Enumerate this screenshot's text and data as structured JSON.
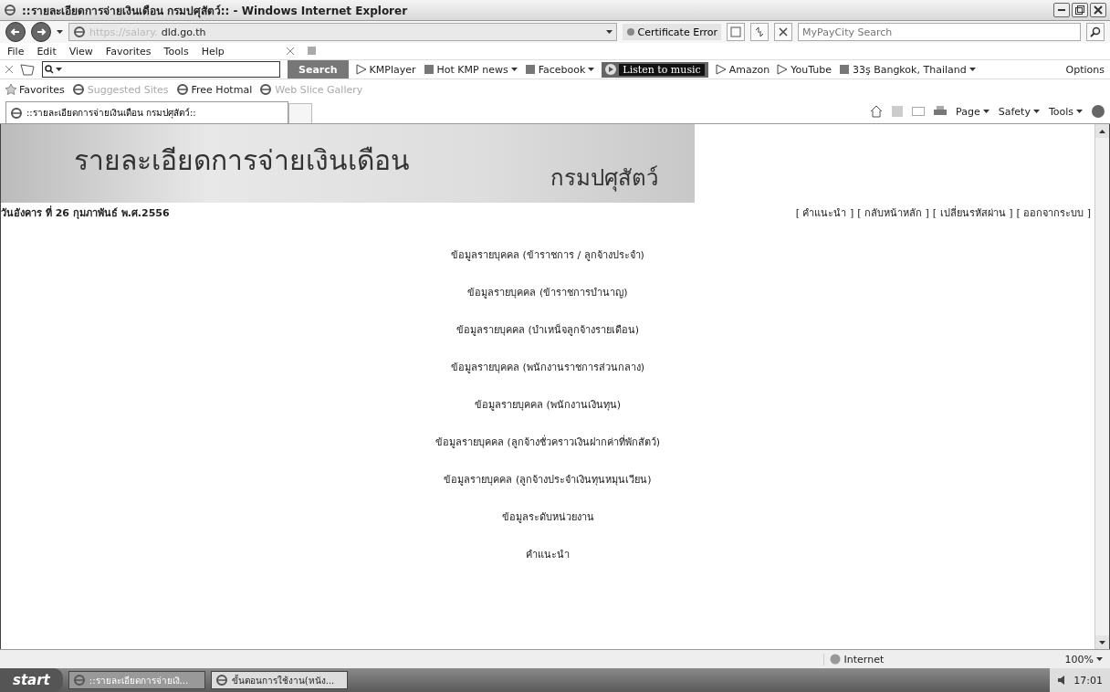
{
  "window": {
    "title": "::รายละเอียดการจ่ายเงินเดือน กรมปศุสัตว์:: - Windows Internet Explorer"
  },
  "address_bar": {
    "url_prefix": "https://salary.",
    "url_domain": "dld.go.th",
    "certificate": "Certificate Error",
    "search_placeholder": "MyPayCity Search"
  },
  "menu_bar": [
    "File",
    "Edit",
    "View",
    "Favorites",
    "Tools",
    "Help"
  ],
  "ask_toolbar": {
    "search_button": "Search",
    "items": [
      {
        "kind": "link",
        "label": "KMPlayer"
      },
      {
        "kind": "dropdown",
        "label": "Hot KMP news"
      },
      {
        "kind": "dropdown",
        "label": "Facebook"
      },
      {
        "kind": "player",
        "label": "Listen to music"
      },
      {
        "kind": "link",
        "label": "Amazon"
      },
      {
        "kind": "link",
        "label": "YouTube"
      },
      {
        "kind": "dropdown",
        "label": "33ş Bangkok, Thailand"
      }
    ],
    "options": "Options"
  },
  "favorites_bar": {
    "label": "Favorites",
    "items": [
      {
        "label": "Suggested Sites",
        "disabled": true
      },
      {
        "label": "Free Hotmal",
        "disabled": false
      },
      {
        "label": "Web Slice Gallery",
        "disabled": true
      }
    ]
  },
  "tab": {
    "title": "::รายละเอียดการจ่ายเงินเดือน กรมปศุสัตว์::"
  },
  "command_bar": [
    "Page",
    "Safety",
    "Tools"
  ],
  "page": {
    "banner_title": "รายละเอียดการจ่ายเงินเดือน",
    "banner_department": "กรมปศุสัตว์",
    "date": "วันอังคาร ที่ 26 กุมภาพันธ์ พ.ศ.2556",
    "top_links": [
      "[ คำแนะนำ ]",
      "[ กลับหน้าหลัก ]",
      "[ เปลี่ยนรหัสผ่าน ]",
      "[ ออกจากระบบ ]"
    ],
    "menu": [
      "ข้อมูลรายบุคคล (ข้าราชการ / ลูกจ้างประจำ)",
      "ข้อมูลรายบุคคล (ข้าราชการบำนาญ)",
      "ข้อมูลรายบุคคล (บำเหน็จลูกจ้างรายเดือน)",
      "ข้อมูลรายบุคคล (พนักงานราชการส่วนกลาง)",
      "ข้อมูลรายบุคคล (พนักงานเงินทุน)",
      "ข้อมูลรายบุคคล (ลูกจ้างชั่วคราวเงินฝากค่าที่พักสัตว์)",
      "ข้อมูลรายบุคคล (ลูกจ้างประจำเงินทุนหมุนเวียน)",
      "ข้อมูลระดับหน่วยงาน",
      "คำแนะนำ"
    ]
  },
  "status_bar": {
    "zone": "Internet",
    "zoom": "100%"
  },
  "taskbar": {
    "start": "start",
    "tasks": [
      {
        "label": "::รายละเอียดการจ่ายเงิ...",
        "selected": true
      },
      {
        "label": "ขั้นตอนการใช้งาน(หนัง...",
        "selected": false
      }
    ],
    "clock": "17:01"
  }
}
